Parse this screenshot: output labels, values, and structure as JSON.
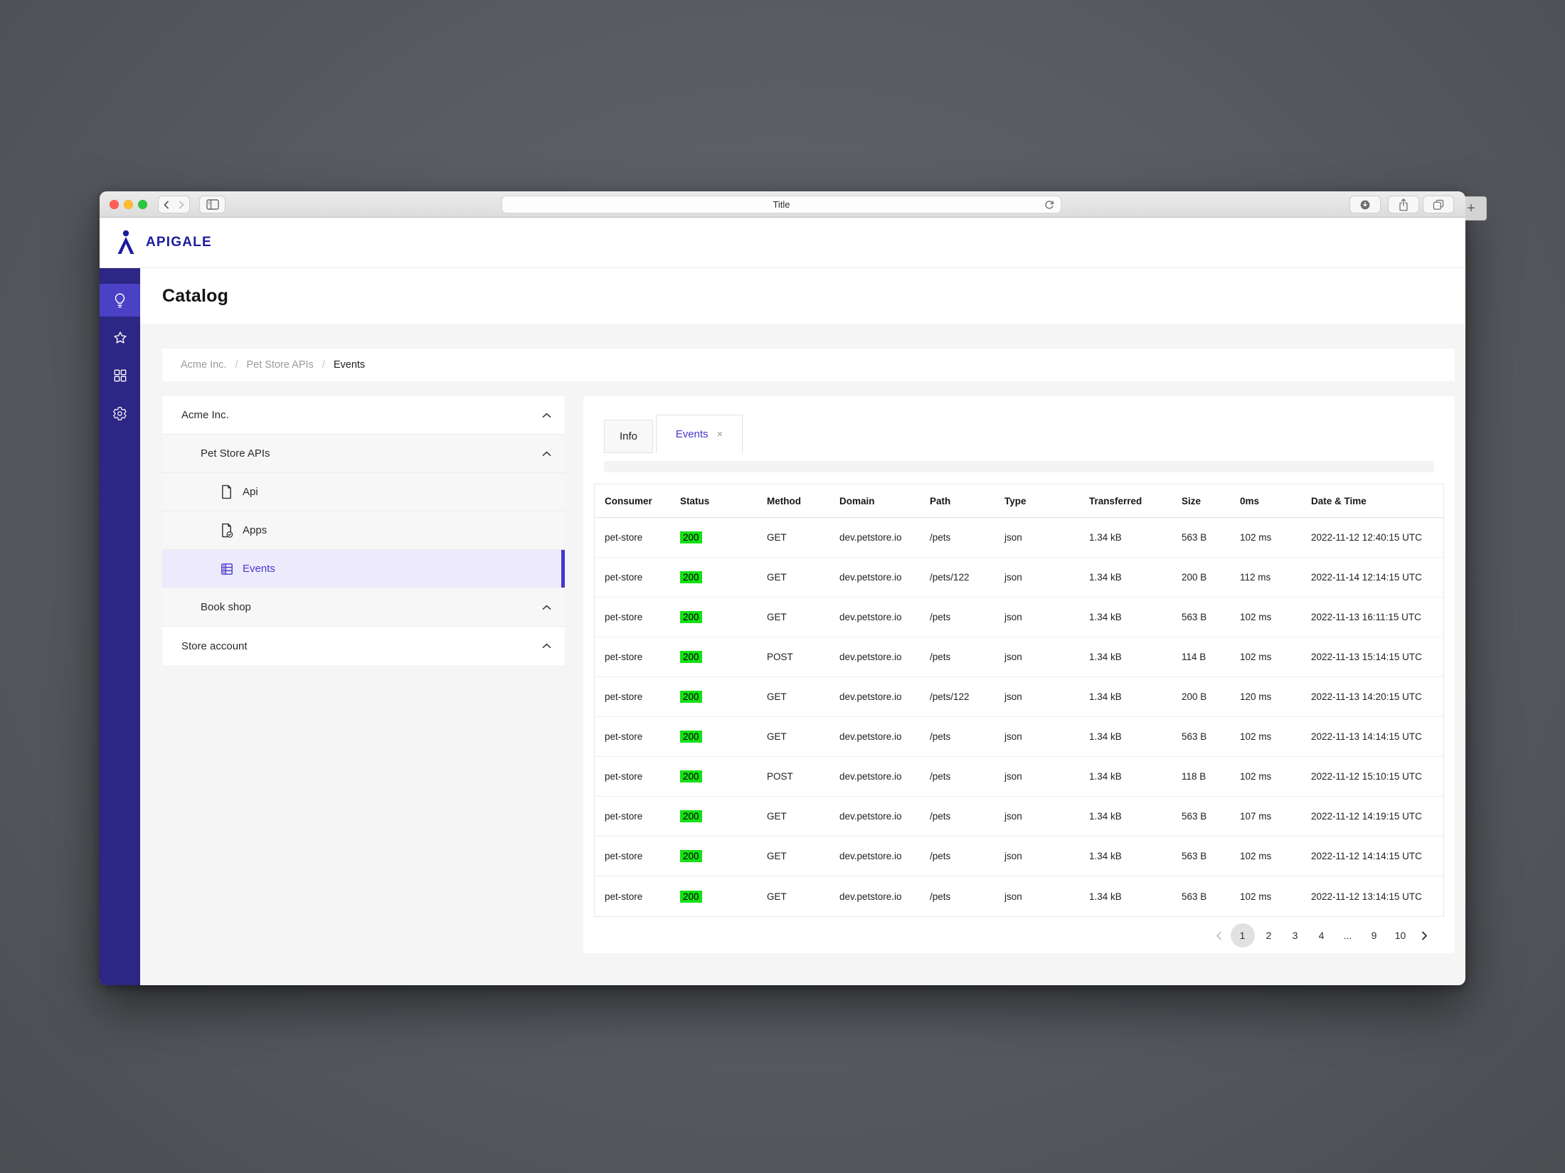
{
  "colors": {
    "accent": "#4636d0",
    "brand_navy": "#1c1c9e",
    "rail_bg": "#2c2684",
    "rail_active_bg": "#4a41c4",
    "status_green": "#15e015",
    "selected_row_bg": "#edebfb"
  },
  "browser": {
    "url_text": "Title",
    "new_tab_label": "+"
  },
  "app": {
    "brand": "APIGALE",
    "page_title": "Catalog",
    "breadcrumb": {
      "items": [
        "Acme Inc.",
        "Pet Store APIs",
        "Events"
      ],
      "separator": "/"
    },
    "nav_rail": [
      {
        "icon": "lightbulb",
        "active": true
      },
      {
        "icon": "star",
        "active": false
      },
      {
        "icon": "grid",
        "active": false
      },
      {
        "icon": "gear",
        "active": false
      }
    ],
    "tree": {
      "items": [
        {
          "label": "Acme Inc.",
          "level": 0,
          "icon": null
        },
        {
          "label": "Pet Store APIs",
          "level": 1,
          "icon": null
        },
        {
          "label": "Api",
          "level": 2,
          "icon": "file"
        },
        {
          "label": "Apps",
          "level": 2,
          "icon": "file-badge"
        },
        {
          "label": "Events",
          "level": 2,
          "icon": "table",
          "selected": true
        },
        {
          "label": "Book shop",
          "level": 1,
          "icon": null
        },
        {
          "label": "Store account",
          "level": 0,
          "icon": null
        }
      ]
    },
    "panel": {
      "tabs": [
        {
          "label": "Info",
          "active": false
        },
        {
          "label": "Events",
          "active": true,
          "close": "×"
        }
      ],
      "table": {
        "columns": [
          "Consumer",
          "Status",
          "Method",
          "Domain",
          "Path",
          "Type",
          "Transferred",
          "Size",
          "0ms",
          "Date & Time"
        ],
        "rows": [
          [
            "pet-store",
            "200",
            "GET",
            "dev.petstore.io",
            "/pets",
            "json",
            "1.34 kB",
            "563 B",
            "102 ms",
            "2022-11-12 12:40:15 UTC"
          ],
          [
            "pet-store",
            "200",
            "GET",
            "dev.petstore.io",
            "/pets/122",
            "json",
            "1.34 kB",
            "200 B",
            "112 ms",
            "2022-11-14 12:14:15 UTC"
          ],
          [
            "pet-store",
            "200",
            "GET",
            "dev.petstore.io",
            "/pets",
            "json",
            "1.34 kB",
            "563 B",
            "102 ms",
            "2022-11-13 16:11:15 UTC"
          ],
          [
            "pet-store",
            "200",
            "POST",
            "dev.petstore.io",
            "/pets",
            "json",
            "1.34 kB",
            "114 B",
            "102 ms",
            "2022-11-13 15:14:15 UTC"
          ],
          [
            "pet-store",
            "200",
            "GET",
            "dev.petstore.io",
            "/pets/122",
            "json",
            "1.34 kB",
            "200 B",
            "120 ms",
            "2022-11-13 14:20:15 UTC"
          ],
          [
            "pet-store",
            "200",
            "GET",
            "dev.petstore.io",
            "/pets",
            "json",
            "1.34 kB",
            "563 B",
            "102 ms",
            "2022-11-13 14:14:15 UTC"
          ],
          [
            "pet-store",
            "200",
            "POST",
            "dev.petstore.io",
            "/pets",
            "json",
            "1.34 kB",
            "118 B",
            "102 ms",
            "2022-11-12 15:10:15 UTC"
          ],
          [
            "pet-store",
            "200",
            "GET",
            "dev.petstore.io",
            "/pets",
            "json",
            "1.34 kB",
            "563 B",
            "107 ms",
            "2022-11-12 14:19:15 UTC"
          ],
          [
            "pet-store",
            "200",
            "GET",
            "dev.petstore.io",
            "/pets",
            "json",
            "1.34 kB",
            "563 B",
            "102 ms",
            "2022-11-12 14:14:15 UTC"
          ],
          [
            "pet-store",
            "200",
            "GET",
            "dev.petstore.io",
            "/pets",
            "json",
            "1.34 kB",
            "563 B",
            "102 ms",
            "2022-11-12 13:14:15 UTC"
          ]
        ]
      },
      "pagination": {
        "pages": [
          "1",
          "2",
          "3",
          "4",
          "...",
          "9",
          "10"
        ],
        "active_page": "1"
      }
    }
  }
}
